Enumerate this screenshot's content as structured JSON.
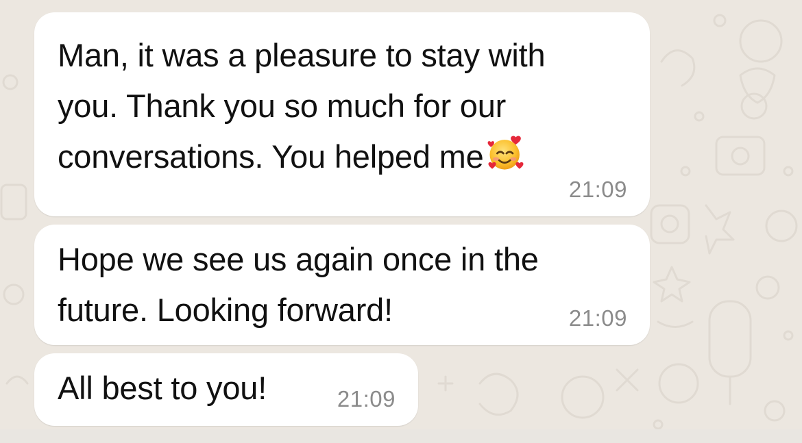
{
  "messages": [
    {
      "lines": [
        "Man, it was a pleasure to stay with",
        "you. Thank you so much for our",
        "conversations. You helped me"
      ],
      "emoji": "smiling-face-with-hearts-icon",
      "time": "21:09"
    },
    {
      "lines": [
        "Hope we see us again once in the",
        "future. Looking forward!"
      ],
      "time": "21:09"
    },
    {
      "lines": [
        "All best to you!"
      ],
      "time": "21:09"
    }
  ],
  "colors": {
    "bubble": "#ffffff",
    "wallpaper": "#ece7e0",
    "text": "#111111",
    "timestamp": "#8b8b8b"
  }
}
